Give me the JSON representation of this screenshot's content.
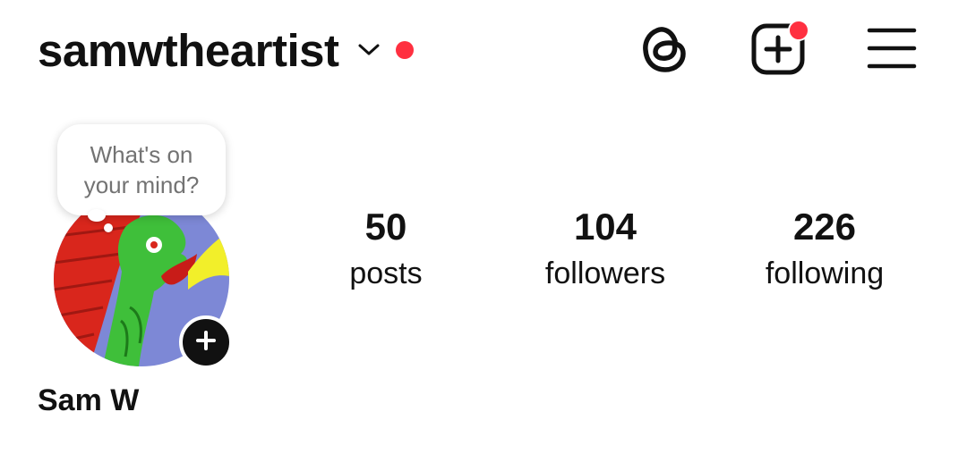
{
  "header": {
    "username": "samwtheartist",
    "chevron_icon": "chevron-down-icon",
    "notification_dot_color": "#ff3040",
    "actions": [
      {
        "icon": "threads-icon"
      },
      {
        "icon": "create-post-icon",
        "badge_color": "#ff3040"
      },
      {
        "icon": "hamburger-menu-icon"
      }
    ]
  },
  "profile": {
    "note_placeholder": "What's on your mind?",
    "avatar": "profile-avatar-artwork",
    "add_story_icon": "plus-icon",
    "display_name": "Sam W"
  },
  "stats": [
    {
      "value": "50",
      "label": "posts"
    },
    {
      "value": "104",
      "label": "followers"
    },
    {
      "value": "226",
      "label": "following"
    }
  ]
}
